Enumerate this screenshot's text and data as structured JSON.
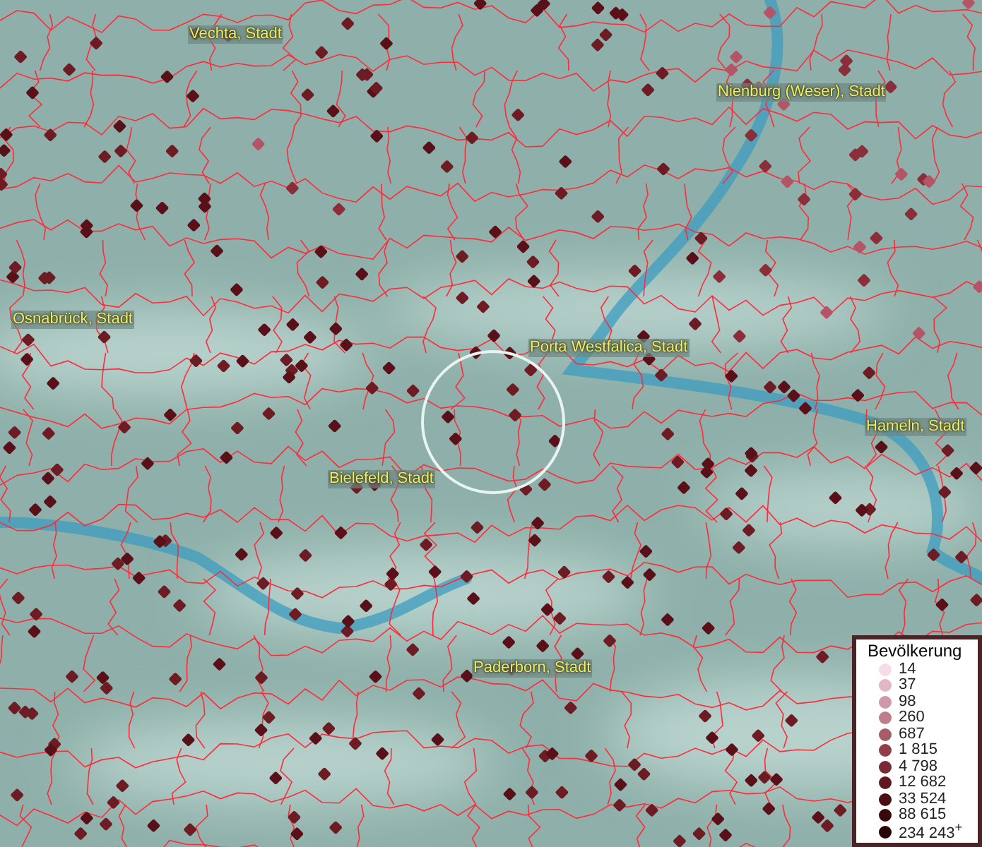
{
  "map": {
    "places": [
      {
        "label": "Vechta, Stadt"
      },
      {
        "label": "Nienburg (Weser), Stadt"
      },
      {
        "label": "Osnabrück, Stadt"
      },
      {
        "label": "Porta Westfalica, Stadt"
      },
      {
        "label": "Hameln, Stadt"
      },
      {
        "label": "Bielefeld, Stadt"
      },
      {
        "label": "Paderborn, Stadt"
      }
    ]
  },
  "legend": {
    "title": "Bevölkerung",
    "items": [
      {
        "label": "14",
        "color": "#f5dce8"
      },
      {
        "label": "37",
        "color": "#e2b6c4"
      },
      {
        "label": "98",
        "color": "#d098a8"
      },
      {
        "label": "260",
        "color": "#bf7c8a"
      },
      {
        "label": "687",
        "color": "#a85c68"
      },
      {
        "label": "1 815",
        "color": "#903e48"
      },
      {
        "label": "4 798",
        "color": "#7a2a33"
      },
      {
        "label": "12 682",
        "color": "#60171e"
      },
      {
        "label": "33 524",
        "color": "#4a0e13"
      },
      {
        "label": "88 615",
        "color": "#39080c"
      },
      {
        "label": "234 243$^{+}$",
        "color": "#280407"
      }
    ]
  }
}
